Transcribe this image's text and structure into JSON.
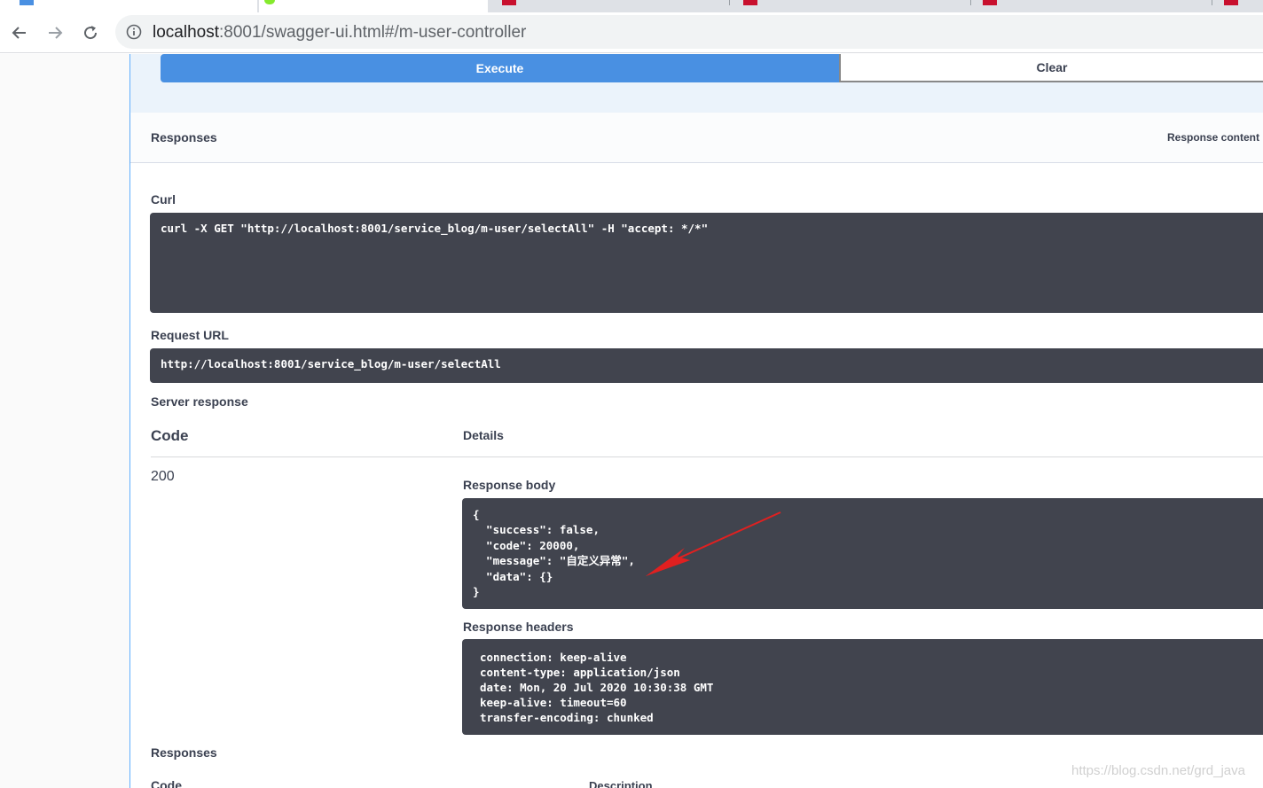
{
  "browser": {
    "url_host": "localhost",
    "url_rest": ":8001/swagger-ui.html#/m-user-controller",
    "icons": [
      "back-arrow-icon",
      "forward-arrow-icon",
      "reload-icon",
      "info-icon"
    ]
  },
  "actions": {
    "execute_label": "Execute",
    "clear_label": "Clear"
  },
  "responses_header": {
    "title": "Responses",
    "content_type_label": "Response content"
  },
  "curl": {
    "label": "Curl",
    "command": "curl -X GET \"http://localhost:8001/service_blog/m-user/selectAll\" -H \"accept: */*\""
  },
  "request_url": {
    "label": "Request URL",
    "value": "http://localhost:8001/service_blog/m-user/selectAll"
  },
  "server_response": {
    "label": "Server response",
    "col_code": "Code",
    "col_details": "Details",
    "status_code": "200",
    "body_label": "Response body",
    "body": "{\n  \"success\": false,\n  \"code\": 20000,\n  \"message\": \"自定义异常\",\n  \"data\": {}\n}",
    "headers_label": "Response headers",
    "headers": "connection: keep-alive\ncontent-type: application/json\ndate: Mon, 20 Jul 2020 10:30:38 GMT\nkeep-alive: timeout=60\ntransfer-encoding: chunked"
  },
  "responses_footer": {
    "title": "Responses",
    "col_code": "Code",
    "col_description": "Description"
  },
  "watermark": "https://blog.csdn.net/grd_java",
  "colors": {
    "execute_bg": "#4990e2",
    "code_bg": "#41444e",
    "panel_bg": "#ebf3fb",
    "annotation_arrow": "#e02020"
  }
}
